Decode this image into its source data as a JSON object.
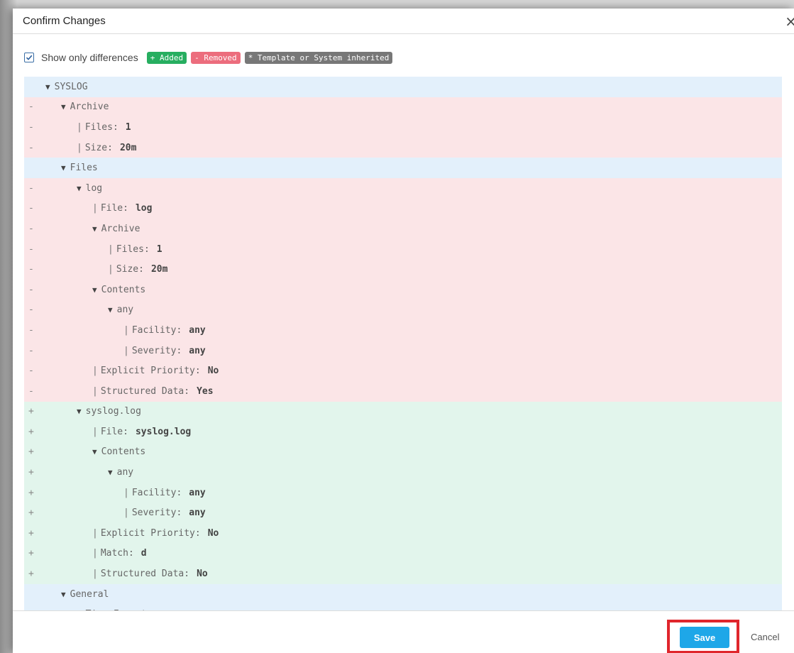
{
  "dialog": {
    "title": "Confirm Changes",
    "close_label": "×"
  },
  "filter": {
    "checkbox_checked": true,
    "label": "Show only differences",
    "badge_added": "+ Added",
    "badge_removed": "- Removed",
    "badge_template": "* Template or System inherited"
  },
  "tree": {
    "rows": [
      {
        "marker": "",
        "type": "neutral",
        "depth": 0,
        "node": true,
        "label": "SYSLOG",
        "value": ""
      },
      {
        "marker": "-",
        "type": "removed",
        "depth": 1,
        "node": true,
        "label": "Archive",
        "value": ""
      },
      {
        "marker": "-",
        "type": "removed",
        "depth": 2,
        "node": false,
        "label": "Files:",
        "value": "1"
      },
      {
        "marker": "-",
        "type": "removed",
        "depth": 2,
        "node": false,
        "label": "Size:",
        "value": "20m"
      },
      {
        "marker": "",
        "type": "neutral",
        "depth": 1,
        "node": true,
        "label": "Files",
        "value": ""
      },
      {
        "marker": "-",
        "type": "removed",
        "depth": 2,
        "node": true,
        "label": "log",
        "value": ""
      },
      {
        "marker": "-",
        "type": "removed",
        "depth": 3,
        "node": false,
        "label": "File:",
        "value": "log"
      },
      {
        "marker": "-",
        "type": "removed",
        "depth": 3,
        "node": true,
        "label": "Archive",
        "value": ""
      },
      {
        "marker": "-",
        "type": "removed",
        "depth": 4,
        "node": false,
        "label": "Files:",
        "value": "1"
      },
      {
        "marker": "-",
        "type": "removed",
        "depth": 4,
        "node": false,
        "label": "Size:",
        "value": "20m"
      },
      {
        "marker": "-",
        "type": "removed",
        "depth": 3,
        "node": true,
        "label": "Contents",
        "value": ""
      },
      {
        "marker": "-",
        "type": "removed",
        "depth": 4,
        "node": true,
        "label": "any",
        "value": ""
      },
      {
        "marker": "-",
        "type": "removed",
        "depth": 5,
        "node": false,
        "label": "Facility:",
        "value": "any"
      },
      {
        "marker": "-",
        "type": "removed",
        "depth": 5,
        "node": false,
        "label": "Severity:",
        "value": "any"
      },
      {
        "marker": "-",
        "type": "removed",
        "depth": 3,
        "node": false,
        "label": "Explicit Priority:",
        "value": "No"
      },
      {
        "marker": "-",
        "type": "removed",
        "depth": 3,
        "node": false,
        "label": "Structured Data:",
        "value": "Yes"
      },
      {
        "marker": "+",
        "type": "added",
        "depth": 2,
        "node": true,
        "label": "syslog.log",
        "value": ""
      },
      {
        "marker": "+",
        "type": "added",
        "depth": 3,
        "node": false,
        "label": "File:",
        "value": "syslog.log"
      },
      {
        "marker": "+",
        "type": "added",
        "depth": 3,
        "node": true,
        "label": "Contents",
        "value": ""
      },
      {
        "marker": "+",
        "type": "added",
        "depth": 4,
        "node": true,
        "label": "any",
        "value": ""
      },
      {
        "marker": "+",
        "type": "added",
        "depth": 5,
        "node": false,
        "label": "Facility:",
        "value": "any"
      },
      {
        "marker": "+",
        "type": "added",
        "depth": 5,
        "node": false,
        "label": "Severity:",
        "value": "any"
      },
      {
        "marker": "+",
        "type": "added",
        "depth": 3,
        "node": false,
        "label": "Explicit Priority:",
        "value": "No"
      },
      {
        "marker": "+",
        "type": "added",
        "depth": 3,
        "node": false,
        "label": "Match:",
        "value": "d"
      },
      {
        "marker": "+",
        "type": "added",
        "depth": 3,
        "node": false,
        "label": "Structured Data:",
        "value": "No"
      },
      {
        "marker": "",
        "type": "neutral",
        "depth": 1,
        "node": true,
        "label": "General",
        "value": ""
      },
      {
        "marker": "",
        "type": "neutral",
        "depth": 2,
        "node": true,
        "label": "Time Format",
        "value": ""
      }
    ]
  },
  "footer": {
    "save_label": "Save",
    "cancel_label": "Cancel"
  },
  "colors": {
    "removed_bg": "#fbe5e7",
    "added_bg": "#e2f5ec",
    "neutral_bg": "#e3f0fb",
    "save_button": "#1ea7e8",
    "highlight_box": "#e0262c"
  }
}
